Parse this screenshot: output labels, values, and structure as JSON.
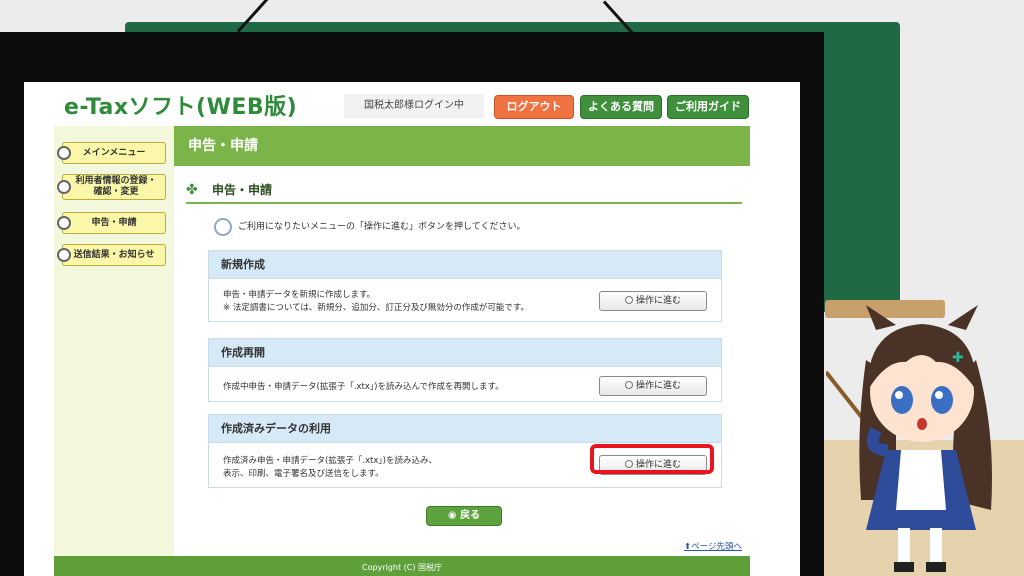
{
  "header": {
    "logo": "e-Taxソフト(WEB版)",
    "user_status": "国税太郎様ログイン中",
    "logout_label": "ログアウト",
    "faq_label": "よくある質問",
    "guide_label": "ご利用ガイド"
  },
  "sidebar": {
    "items": [
      {
        "label": "メインメニュー"
      },
      {
        "label": "利用者情報の登録・確認・変更"
      },
      {
        "label": "申告・申請"
      },
      {
        "label": "送信結果・お知らせ"
      }
    ]
  },
  "main": {
    "title": "申告・申請",
    "subheading": "申告・申請",
    "instruction": "ご利用になりたいメニューの「操作に進む」ボタンを押してください。",
    "panels": [
      {
        "title": "新規作成",
        "line1": "申告・申請データを新規に作成します。",
        "line2": "※ 法定調書については、新規分、追加分、訂正分及び無効分の作成が可能です。",
        "button": "操作に進む"
      },
      {
        "title": "作成再開",
        "line1": "作成中申告・申請データ(拡張子「.xtx」)を読み込んで作成を再開します。",
        "button": "操作に進む"
      },
      {
        "title": "作成済みデータの利用",
        "line1": "作成済み申告・申請データ(拡張子「.xtx」)を読み込み、",
        "line2": "表示、印刷、電子署名及び送信をします。",
        "button": "操作に進む"
      }
    ],
    "back_label": "戻る",
    "page_top_label": "ページ先頭へ"
  },
  "footer": {
    "copyright": "Copyright (C) 国税庁"
  },
  "colors": {
    "brand_green": "#7bb549",
    "logout_orange": "#ef7240",
    "highlight_red": "#e8141e",
    "panel_head_blue": "#d5e9f6"
  },
  "icons": [
    "clover-icon",
    "info-icon",
    "arrow-up-icon",
    "chevron-circle-icon"
  ]
}
